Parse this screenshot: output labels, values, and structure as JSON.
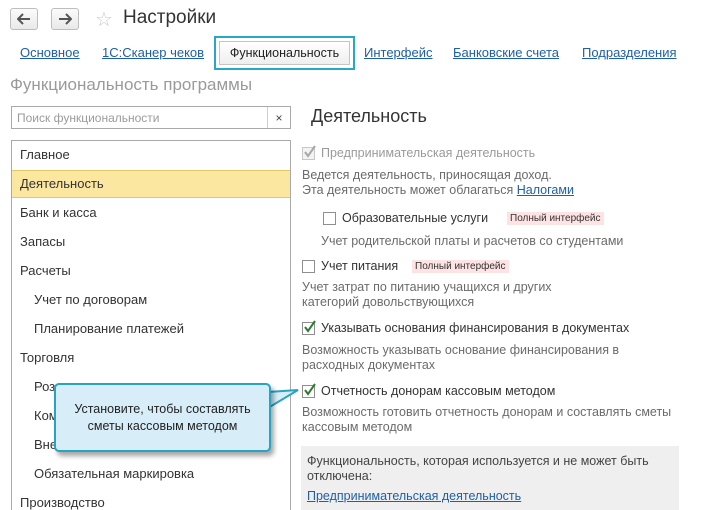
{
  "header": {
    "title": "Настройки"
  },
  "tabs": [
    {
      "label": "Основное"
    },
    {
      "label": "1С:Сканер чеков"
    },
    {
      "label": "Функциональность"
    },
    {
      "label": "Интерфейс"
    },
    {
      "label": "Банковские счета"
    },
    {
      "label": "Подразделения"
    }
  ],
  "section": {
    "title": "Функциональность программы"
  },
  "search": {
    "placeholder": "Поиск функциональности",
    "clear": "×"
  },
  "sidebar": {
    "items": [
      {
        "label": "Главное"
      },
      {
        "label": "Деятельность",
        "selected": true
      },
      {
        "label": "Банк и касса"
      },
      {
        "label": "Запасы"
      },
      {
        "label": "Расчеты"
      },
      {
        "label": "Учет по договорам"
      },
      {
        "label": "Планирование платежей"
      },
      {
        "label": "Торговля"
      },
      {
        "label": "Роз"
      },
      {
        "label": "Ком"
      },
      {
        "label": "Вне"
      },
      {
        "label": "Обязательная маркировка"
      },
      {
        "label": "Производство"
      }
    ]
  },
  "panel": {
    "title": "Деятельность",
    "options": [
      {
        "label": "Предпринимательская деятельность",
        "checked": true,
        "disabled": true,
        "desc1": "Ведется деятельность, приносящая доход.",
        "desc2": "Эта деятельность может облагаться",
        "desc_link": "Налогами"
      },
      {
        "label": "Образовательные услуги",
        "checked": false,
        "badge": "Полный интерфейс",
        "desc": "Учет родительской платы и расчетов со студентами"
      },
      {
        "label": "Учет питания",
        "checked": false,
        "badge": "Полный интерфейс",
        "desc1": "Учет затрат по питанию учащихся и других",
        "desc2": "категорий довольствующихся"
      },
      {
        "label": "Указывать основания финансирования в документах",
        "checked": true,
        "desc1": "Возможность указывать основание финансирования в",
        "desc2": "расходных документах"
      },
      {
        "label": "Отчетность донорам кассовым методом",
        "checked": true,
        "desc1": "Возможность готовить отчетность донорам и составлять сметы",
        "desc2": "кассовым методом"
      }
    ],
    "info": {
      "text1": "Функциональность, которая используется и не может быть",
      "text2": "отключена:",
      "link": "Предпринимательская деятельность"
    }
  },
  "tooltip": {
    "line1": "Установите, чтобы составлять",
    "line2": "сметы кассовым методом"
  },
  "colors": {
    "link": "#1f5fa8",
    "selected_row": "#fbe7a0",
    "tooltip_bg": "#d7eef8",
    "tooltip_border": "#2aa3c3",
    "badge_bg": "#fde3e3"
  }
}
